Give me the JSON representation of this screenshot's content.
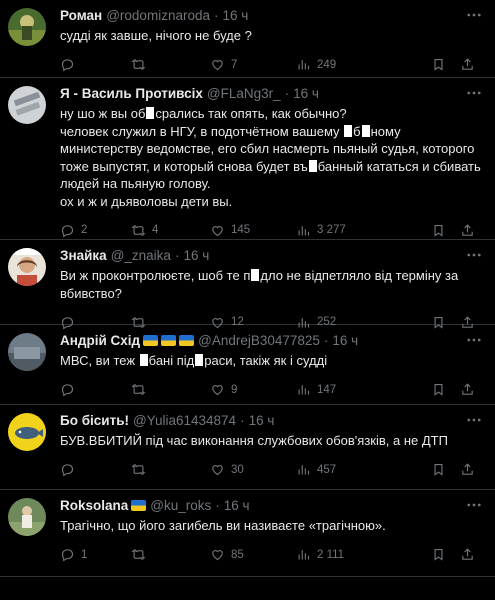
{
  "tweets": [
    {
      "name": "Роман",
      "handle": "@rodomiznaroda",
      "time": "16 ч",
      "lines": [
        "судді як завше, нічого не буде ?"
      ],
      "replies": "",
      "retweets": "",
      "likes": "7",
      "views": "249"
    },
    {
      "name": "Я - Василь Противсіх",
      "handle": "@FLaNg3r_",
      "time": "16 ч",
      "lines": [
        "ну шо ж вы об◼срались так опять, как обычно?",
        "человек служил в НГУ, в подотчётном вашему ◼б◼ному министерству ведомстве, его сбил насмерть пьяный судья, которого тоже выпустят, и который снова будет въ◼банный кататься и сбивать людей на пьяную голову.",
        "ох и ж и дьяволовы дети вы."
      ],
      "replies": "2",
      "retweets": "4",
      "likes": "145",
      "views": "3 277"
    },
    {
      "name": "Знайка",
      "handle": "@_znaika",
      "time": "16 ч",
      "lines": [
        "Ви ж проконтролюєте, шоб те п◼дло не відпетляло від терміну за вбивство?"
      ],
      "replies": "",
      "retweets": "",
      "likes": "12",
      "views": "252"
    },
    {
      "name": "Андрій Схід",
      "handle": "@AndrejB30477825",
      "time": "16 ч",
      "lines": [
        "МВС, ви теж ◼бані під◼раси, такіж як і судді"
      ],
      "replies": "",
      "retweets": "",
      "likes": "9",
      "views": "147"
    },
    {
      "name": "Бо бісить!",
      "handle": "@Yulia61434874",
      "time": "16 ч",
      "lines": [
        "БУВ.ВБИТИЙ під час виконання службових обов'язків, а не ДТП"
      ],
      "replies": "",
      "retweets": "",
      "likes": "30",
      "views": "457"
    },
    {
      "name": "Roksolana",
      "handle": "@ku_roks",
      "time": "16 ч",
      "lines": [
        "Трагічно, що його загибель ви називаєте «трагічною»."
      ],
      "replies": "1",
      "retweets": "",
      "likes": "85",
      "views": "2 111"
    }
  ],
  "icons": {
    "reply": "reply-icon",
    "retweet": "retweet-icon",
    "like": "heart-icon",
    "views": "views-icon",
    "share": "share-icon",
    "more": "more-icon"
  },
  "colors": {
    "background": "#000000",
    "text": "#e7e9ea",
    "muted": "#71767b",
    "divider": "#2f3336"
  }
}
